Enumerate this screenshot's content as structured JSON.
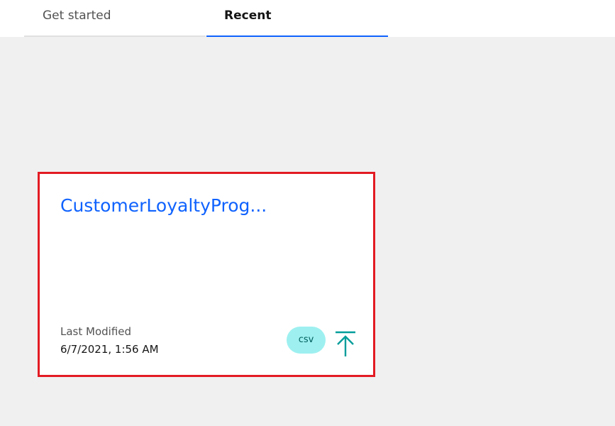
{
  "tabs": [
    {
      "label": "Get started",
      "selected": false
    },
    {
      "label": "Recent",
      "selected": true
    }
  ],
  "recent": {
    "cards": [
      {
        "title": "CustomerLoyaltyProg...",
        "last_modified_label": "Last Modified",
        "last_modified_value": "6/7/2021, 1:56 AM",
        "file_type": "csv",
        "action_icon": "upload-icon"
      }
    ]
  },
  "colors": {
    "accent": "#0f62fe",
    "highlight_border": "#e31b23",
    "badge_bg": "#9ef0f0",
    "icon_teal": "#009d9a"
  }
}
